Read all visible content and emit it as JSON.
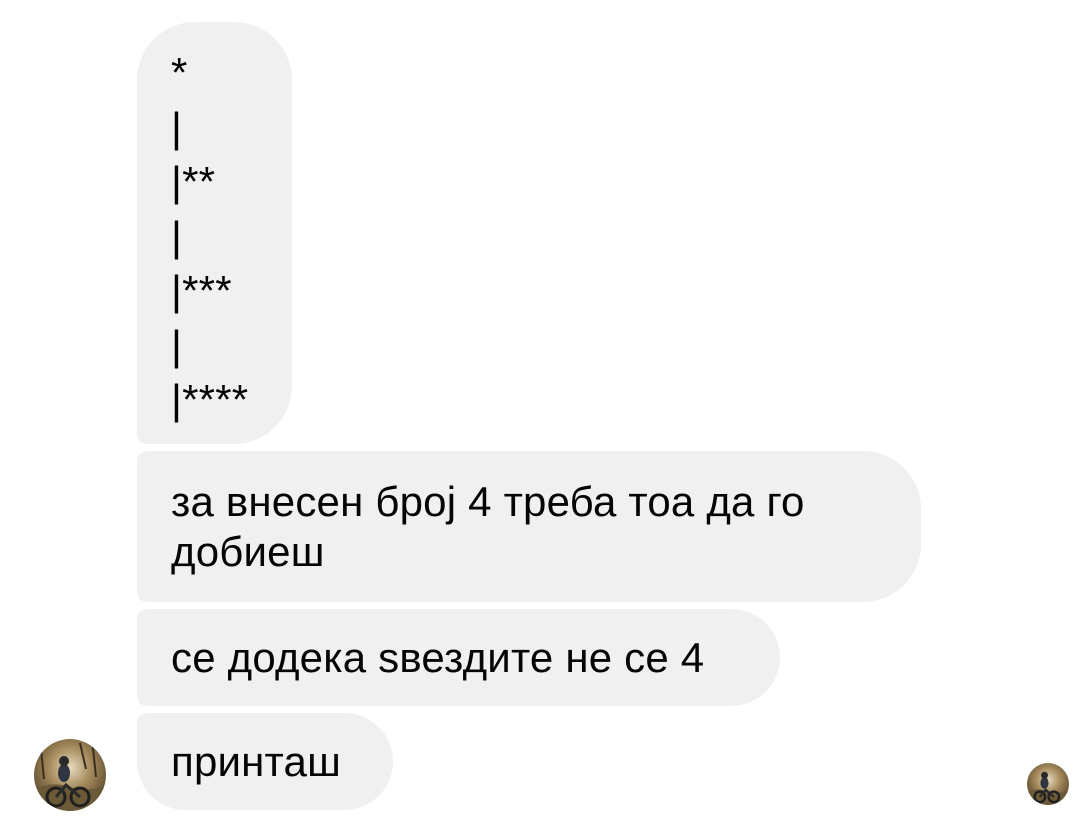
{
  "conversation": {
    "messages": [
      {
        "id": "pattern",
        "lines": [
          "*",
          "|",
          "|**",
          "|",
          "|***",
          "|",
          "|****"
        ]
      },
      {
        "id": "explain",
        "text": "за внесен број 4 треба тоа да го добиеш"
      },
      {
        "id": "condition",
        "text": "се додека ѕвездите не се 4"
      },
      {
        "id": "print",
        "text": "принташ"
      }
    ],
    "bubble_color": "#f0f0f0",
    "text_color": "#050505"
  },
  "avatars": {
    "sender": {
      "icon": "profile-photo-icon"
    },
    "read_receipt": {
      "icon": "seen-avatar-icon"
    }
  }
}
